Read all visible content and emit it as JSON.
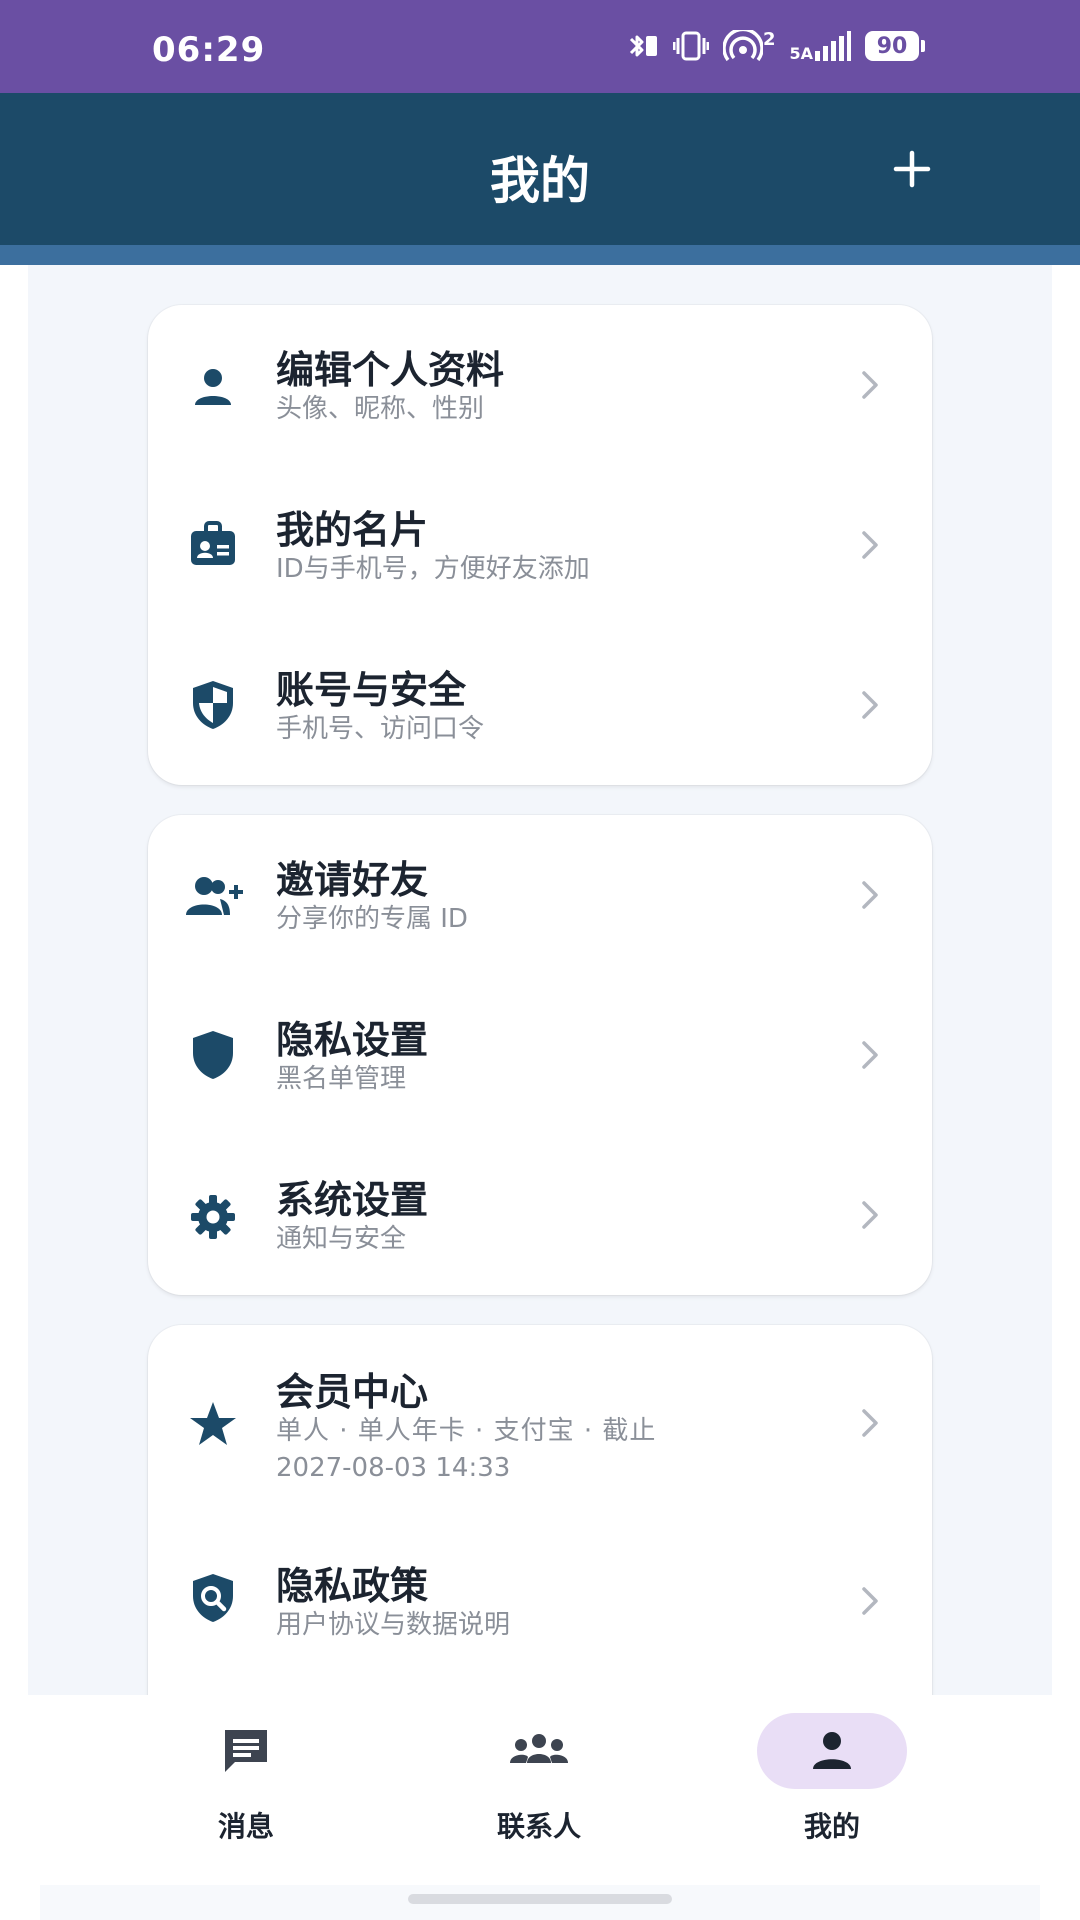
{
  "status_bar": {
    "time": "06:29",
    "network_label": "5A",
    "wifi_label": "2",
    "battery": "90",
    "icons": [
      "bluetooth-icon",
      "vibrate-icon",
      "hotspot-icon",
      "signal-icon",
      "battery-icon"
    ]
  },
  "header": {
    "title": "我的",
    "add_icon": "plus-icon"
  },
  "cards": [
    {
      "items": [
        {
          "icon": "person-icon",
          "title": "编辑个人资料",
          "subtitle": "头像、昵称、性别"
        },
        {
          "icon": "id-card-icon",
          "title": "我的名片",
          "subtitle": "ID与手机号，方便好友添加"
        },
        {
          "icon": "shield-half-icon",
          "title": "账号与安全",
          "subtitle": "手机号、访问口令"
        }
      ]
    },
    {
      "items": [
        {
          "icon": "add-person-icon",
          "title": "邀请好友",
          "subtitle": "分享你的专属 ID"
        },
        {
          "icon": "shield-icon",
          "title": "隐私设置",
          "subtitle": "黑名单管理"
        },
        {
          "icon": "gear-icon",
          "title": "系统设置",
          "subtitle": "通知与安全"
        }
      ]
    },
    {
      "items": [
        {
          "icon": "star-icon",
          "title": "会员中心",
          "subtitle": "单人 · 单人年卡 · 支付宝 · 截止",
          "subtitle2": "2027-08-03 14:33"
        },
        {
          "icon": "shield-search-icon",
          "title": "隐私政策",
          "subtitle": "用户协议与数据说明"
        }
      ]
    }
  ],
  "bottom_nav": {
    "tabs": [
      {
        "icon": "message-icon",
        "label": "消息",
        "active": false
      },
      {
        "icon": "group-icon",
        "label": "联系人",
        "active": false
      },
      {
        "icon": "person-icon",
        "label": "我的",
        "active": true
      }
    ]
  },
  "colors": {
    "status_bar": "#6a4fa3",
    "header": "#1c4a68",
    "icon": "#1c4a68",
    "active_pill": "#e9def6"
  }
}
